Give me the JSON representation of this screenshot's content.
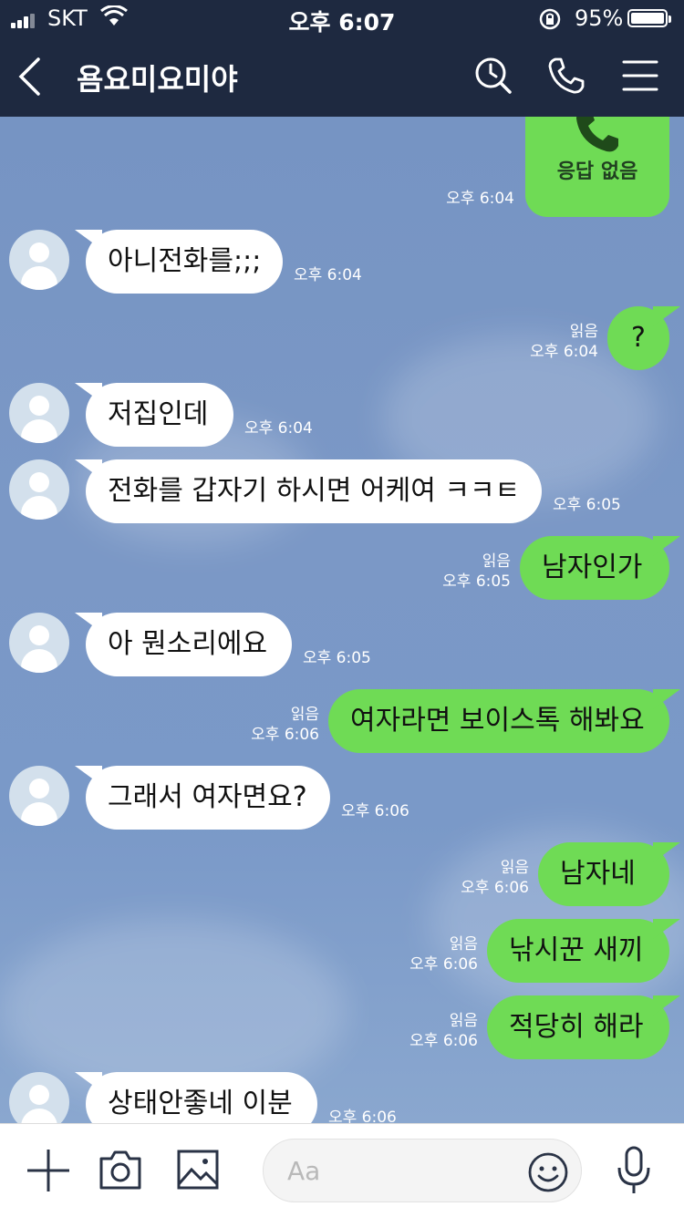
{
  "status": {
    "carrier": "SKT",
    "time": "오후 6:07",
    "battery": "95%",
    "battery_level": 0.95
  },
  "header": {
    "title": "욤요미요미야",
    "icons": [
      "back-icon",
      "search-history-icon",
      "phone-icon",
      "menu-icon"
    ]
  },
  "call_card": {
    "label": "응답 없음",
    "time": "오후 6:04"
  },
  "messages": [
    {
      "dir": "in",
      "text": "아니전화를;;;",
      "time": "오후 6:04"
    },
    {
      "dir": "out",
      "text": "?",
      "read": "읽음",
      "time": "오후 6:04"
    },
    {
      "dir": "in",
      "text": "저집인데",
      "time": "오후 6:04"
    },
    {
      "dir": "in",
      "text": "전화를 갑자기 하시면 어케여 ㅋㅋㅌ",
      "time": "오후 6:05"
    },
    {
      "dir": "out",
      "text": "남자인가",
      "read": "읽음",
      "time": "오후 6:05"
    },
    {
      "dir": "in",
      "text": "아 뭔소리에요",
      "time": "오후 6:05"
    },
    {
      "dir": "out",
      "text": "여자라면 보이스톡 해봐요",
      "read": "읽음",
      "time": "오후 6:06"
    },
    {
      "dir": "in",
      "text": "그래서 여자면요?",
      "time": "오후 6:06"
    },
    {
      "dir": "out",
      "text": "남자네",
      "read": "읽음",
      "time": "오후 6:06"
    },
    {
      "dir": "out",
      "text": "낚시꾼 새끼",
      "read": "읽음",
      "time": "오후 6:06"
    },
    {
      "dir": "out",
      "text": "적당히 해라",
      "read": "읽음",
      "time": "오후 6:06"
    },
    {
      "dir": "in",
      "text": "상태안좋네 이분",
      "time": "오후 6:06"
    }
  ],
  "input": {
    "placeholder": "Aa"
  },
  "bottom_icons": [
    "plus-icon",
    "camera-icon",
    "image-icon",
    "emoji-icon",
    "mic-icon"
  ],
  "colors": {
    "header": "#1e2940",
    "my_bubble": "#6fdb55",
    "their_bubble": "#ffffff",
    "background": "#7694c3"
  }
}
